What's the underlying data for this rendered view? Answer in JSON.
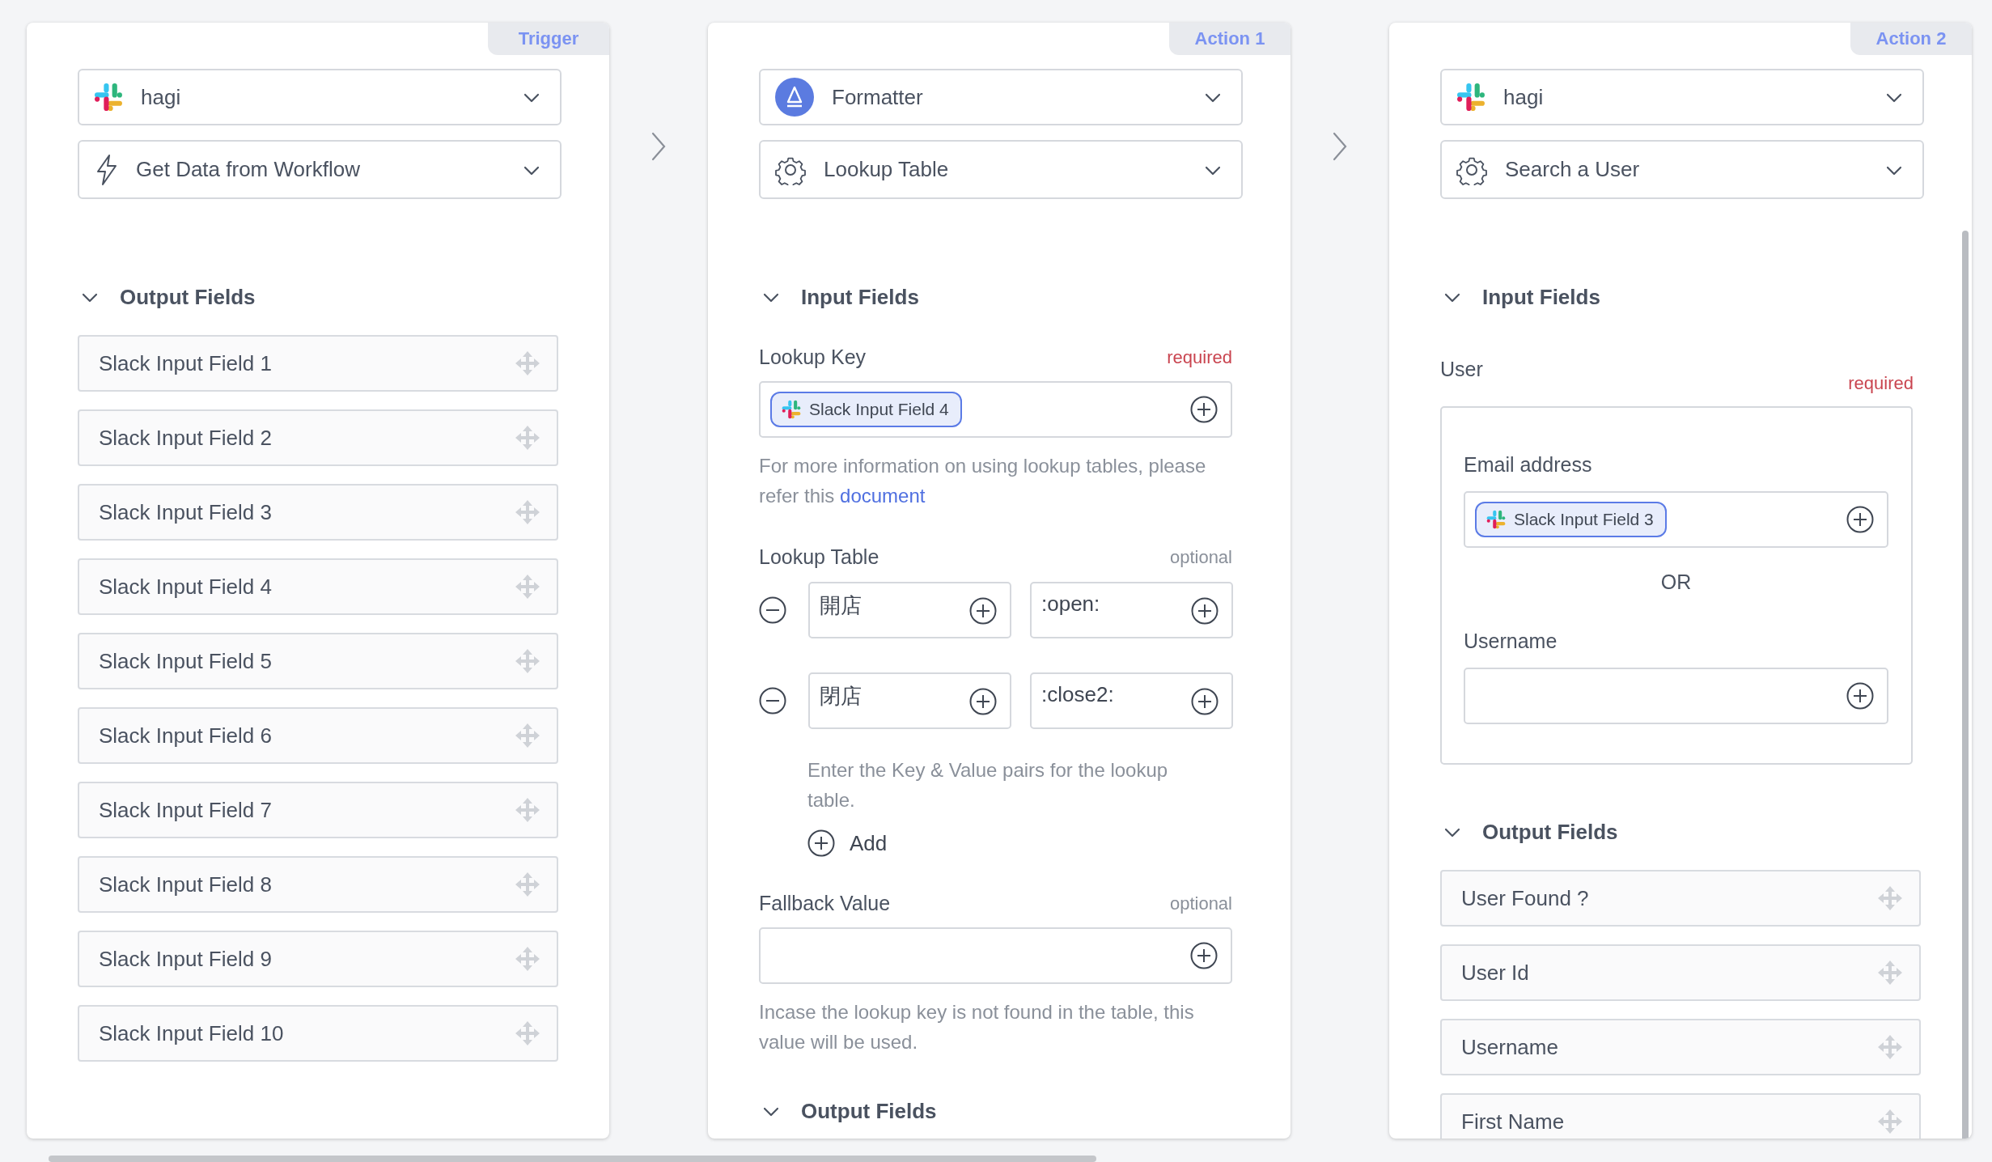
{
  "steps": [
    {
      "kind": "trigger",
      "tab": "Trigger",
      "app": {
        "name": "hagi",
        "kind": "integration"
      },
      "event": {
        "name": "Get Data from Workflow"
      },
      "sections": [
        {
          "kind": "output",
          "title": "Output Fields",
          "expanded": true,
          "items": [
            "Slack Input Field 1",
            "Slack Input Field 2",
            "Slack Input Field 3",
            "Slack Input Field 4",
            "Slack Input Field 5",
            "Slack Input Field 6",
            "Slack Input Field 7",
            "Slack Input Field 8",
            "Slack Input Field 9",
            "Slack Input Field 10"
          ]
        }
      ]
    },
    {
      "kind": "action",
      "tab": "Action 1",
      "app": {
        "name": "Formatter",
        "kind": "builtin"
      },
      "event": {
        "name": "Lookup Table"
      },
      "sections": [
        {
          "kind": "input",
          "title": "Input Fields",
          "expanded": true,
          "fields": [
            {
              "kind": "single",
              "label": "Lookup Key",
              "requirement": "required",
              "required": true,
              "tokens": [
                "Slack Input Field 4"
              ],
              "help": "For more information on using lookup tables, please refer this",
              "help_link": "document"
            },
            {
              "kind": "table",
              "label": "Lookup Table",
              "requirement": "optional",
              "required": false,
              "rows": [
                {
                  "key": "開店",
                  "value": ":open:"
                },
                {
                  "key": "閉店",
                  "value": ":close2:"
                }
              ],
              "help": "Enter the Key & Value pairs for the lookup table.",
              "add": "Add"
            },
            {
              "kind": "single",
              "label": "Fallback Value",
              "requirement": "optional",
              "required": false,
              "help": "Incase the lookup key is not found in the table, this value will be used."
            }
          ]
        },
        {
          "kind": "output",
          "title": "Output Fields",
          "expanded": true
        }
      ]
    },
    {
      "kind": "action",
      "tab": "Action 2",
      "app": {
        "name": "hagi",
        "kind": "integration"
      },
      "event": {
        "name": "Search a User"
      },
      "sections": [
        {
          "kind": "input",
          "title": "Input Fields",
          "expanded": true,
          "fields": [
            {
              "kind": "group",
              "label": "User",
              "requirement": "required",
              "required": true,
              "separator": "OR",
              "options": [
                {
                  "label": "Email address",
                  "tokens": [
                    "Slack Input Field 3"
                  ]
                },
                {
                  "label": "Username"
                }
              ]
            }
          ]
        },
        {
          "kind": "output",
          "title": "Output Fields",
          "expanded": true,
          "items": [
            "User Found ?",
            "User Id",
            "Username",
            "First Name"
          ]
        }
      ]
    }
  ]
}
